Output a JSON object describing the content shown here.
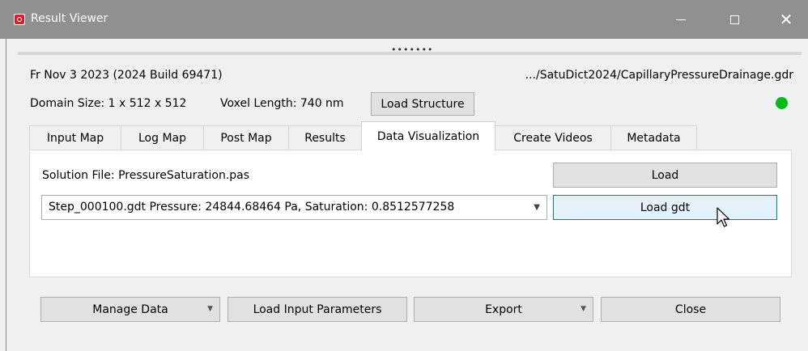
{
  "window": {
    "title": "Result Viewer"
  },
  "header": {
    "date_build": "Fr Nov 3 2023 (2024 Build 69471)",
    "file_path": ".../SatuDict2024/CapillaryPressureDrainage.gdr",
    "domain_size": "Domain Size: 1 x 512 x 512",
    "voxel_length": "Voxel Length: 740 nm",
    "load_structure_label": "Load Structure",
    "status_color": "#00bb1a"
  },
  "tabs": [
    {
      "label": "Input Map"
    },
    {
      "label": "Log Map"
    },
    {
      "label": "Post Map"
    },
    {
      "label": "Results"
    },
    {
      "label": "Data Visualization",
      "active": true
    },
    {
      "label": "Create Videos"
    },
    {
      "label": "Metadata"
    }
  ],
  "panel": {
    "solution_file": "Solution File: PressureSaturation.pas",
    "load_label": "Load",
    "step_selected": "Step_000100.gdt Pressure: 24844.68464 Pa, Saturation: 0.8512577258",
    "load_gdt_label": "Load gdt"
  },
  "footer": {
    "manage_data_label": "Manage Data",
    "load_input_params_label": "Load Input Parameters",
    "export_label": "Export",
    "close_label": "Close"
  },
  "icons": {
    "app": "app-logo-icon",
    "minimize": "minimize-icon",
    "maximize": "maximize-icon",
    "close": "close-icon",
    "cursor": "mouse-pointer-icon"
  }
}
